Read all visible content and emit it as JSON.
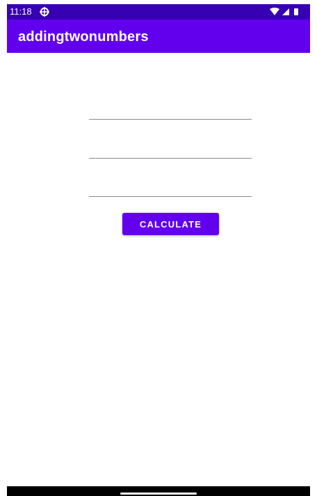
{
  "status_bar": {
    "time": "11:18",
    "icons": [
      "settings-gear-icon",
      "wifi-icon",
      "cellular-signal-icon",
      "battery-icon"
    ]
  },
  "app_bar": {
    "title": "addingtwonumbers"
  },
  "form": {
    "first_number": {
      "value": "",
      "placeholder": ""
    },
    "second_number": {
      "value": "",
      "placeholder": ""
    },
    "result": {
      "value": "",
      "placeholder": ""
    },
    "calculate_label": "CALCULATE"
  },
  "colors": {
    "status_bar": "#3700b3",
    "primary": "#6200ee",
    "on_primary": "#ffffff",
    "background": "#ffffff",
    "nav_bar": "#000000"
  }
}
